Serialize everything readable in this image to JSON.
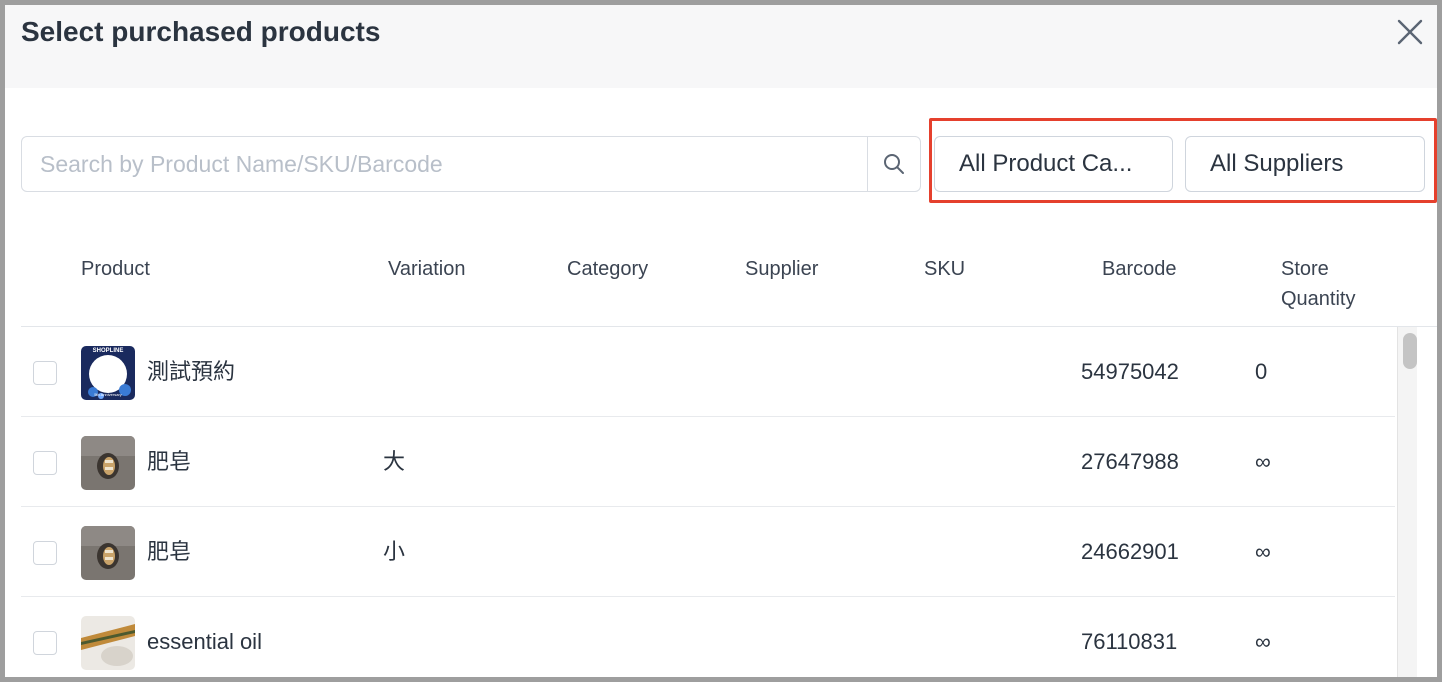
{
  "modal": {
    "title": "Select purchased products"
  },
  "search": {
    "placeholder": "Search by Product Name/SKU/Barcode",
    "value": ""
  },
  "filters": {
    "category_label": "All Product Ca...",
    "supplier_label": "All Suppliers"
  },
  "table": {
    "columns": {
      "product": "Product",
      "variation": "Variation",
      "category": "Category",
      "supplier": "Supplier",
      "sku": "SKU",
      "barcode": "Barcode",
      "store_quantity_line1": "Store",
      "store_quantity_line2": "Quantity"
    },
    "rows": [
      {
        "name": "測試預約",
        "variation": "",
        "category": "",
        "supplier": "",
        "sku": "",
        "barcode": "54975042",
        "quantity": "0",
        "thumb": "shopline-logo-thumbnail"
      },
      {
        "name": "肥皂",
        "variation": "大",
        "category": "",
        "supplier": "",
        "sku": "",
        "barcode": "27647988",
        "quantity": "∞",
        "thumb": "soap-photo-thumbnail"
      },
      {
        "name": "肥皂",
        "variation": "小",
        "category": "",
        "supplier": "",
        "sku": "",
        "barcode": "24662901",
        "quantity": "∞",
        "thumb": "soap-photo-thumbnail"
      },
      {
        "name": "essential oil",
        "variation": "",
        "category": "",
        "supplier": "",
        "sku": "",
        "barcode": "76110831",
        "quantity": "∞",
        "thumb": "oil-photo-thumbnail"
      }
    ]
  },
  "colors": {
    "highlight": "#e5402d",
    "header_bg": "#f7f7f8",
    "title": "#2b3440"
  },
  "logo": {
    "text_top": "SHOPLINE",
    "text_bottom": "5th Anniversary"
  }
}
